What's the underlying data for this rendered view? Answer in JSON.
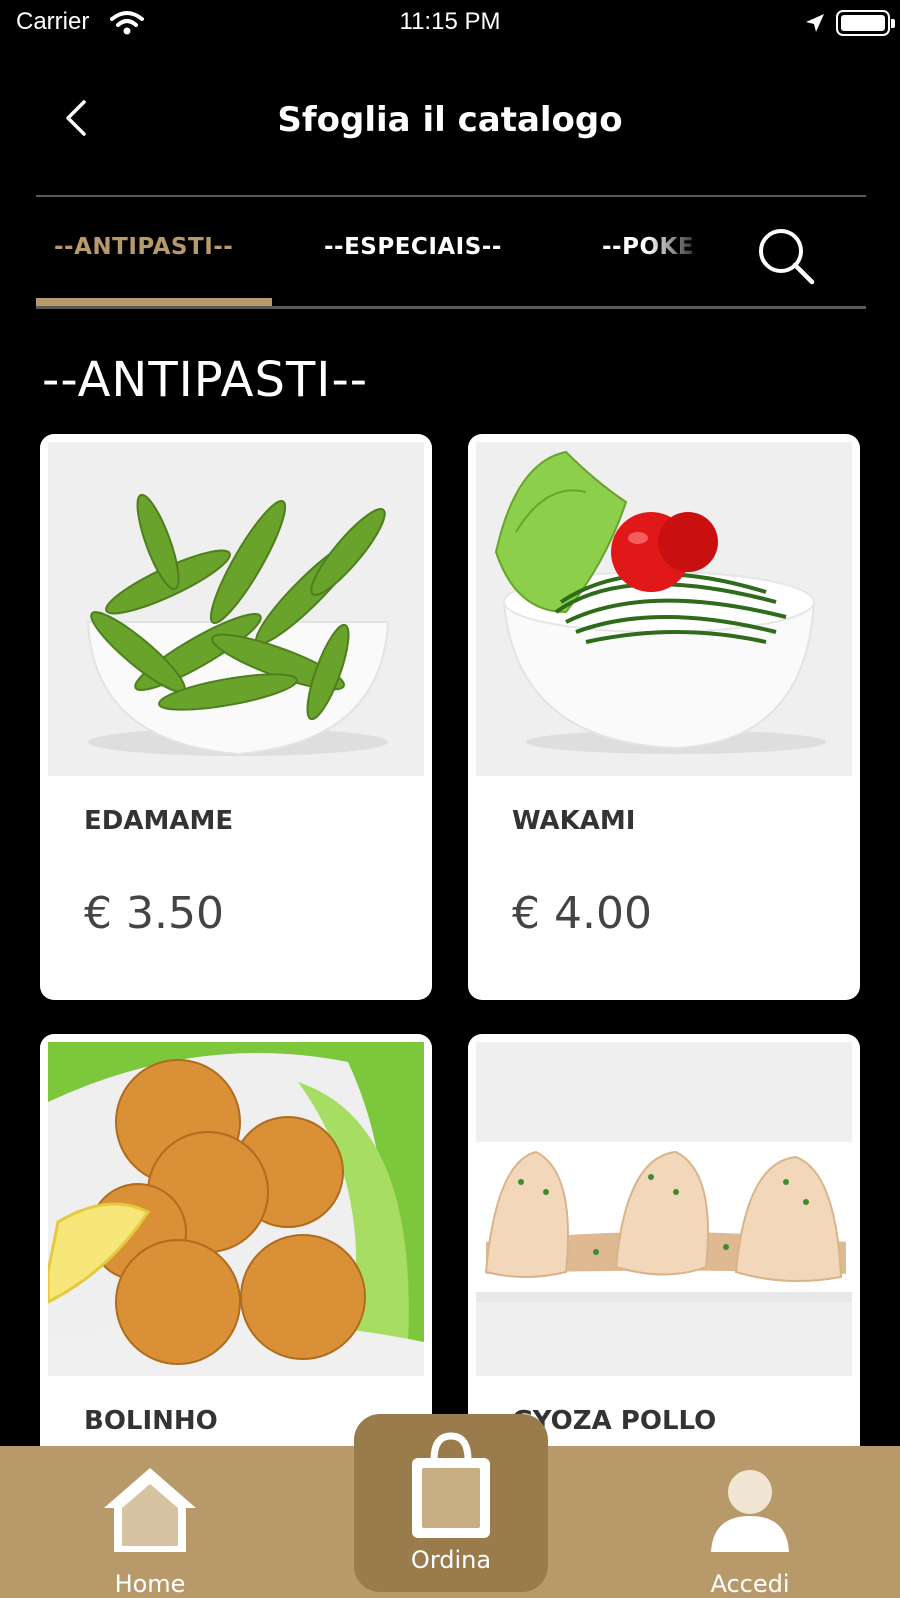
{
  "status_bar": {
    "carrier": "Carrier",
    "time": "11:15 PM"
  },
  "header": {
    "title": "Sfoglia il catalogo"
  },
  "tabs": [
    {
      "label": "--ANTIPASTI--",
      "active": true
    },
    {
      "label": "--ESPECIAIS--",
      "active": false
    },
    {
      "label": "--POKE",
      "active": false
    }
  ],
  "section": {
    "title": "--ANTIPASTI--"
  },
  "products": [
    {
      "name": "EDAMAME",
      "price": "€ 3.50",
      "image": "edamame-bowl"
    },
    {
      "name": "WAKAMI",
      "price": "€ 4.00",
      "image": "seaweed-salad-bowl"
    },
    {
      "name": "BOLINHO",
      "price": "",
      "image": "fried-balls"
    },
    {
      "name": "GYOZA POLLO",
      "price": "",
      "image": "gyoza-plate"
    }
  ],
  "tab_bar": {
    "home_label": "Home",
    "order_label": "Ordina",
    "account_label": "Accedi"
  },
  "colors": {
    "accent": "#b89a6a",
    "accent_dark": "#9a7b4c",
    "background": "#000000",
    "card": "#ffffff"
  }
}
